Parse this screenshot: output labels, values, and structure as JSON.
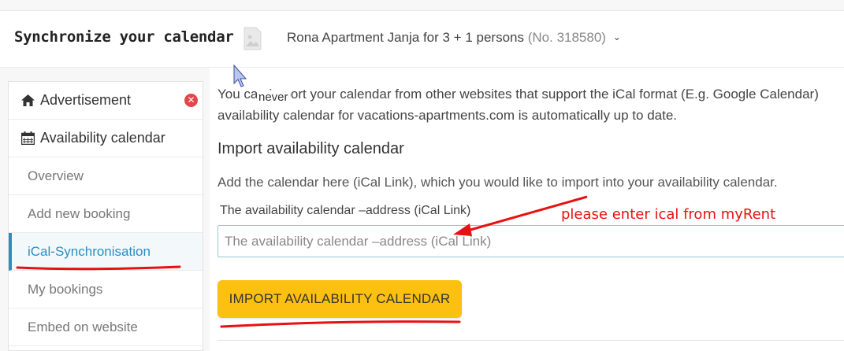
{
  "header": {
    "title": "Synchronize your calendar",
    "property_name": "Rona Apartment Janja for 3 + 1 persons",
    "property_number": "(No. 318580)"
  },
  "sidebar": {
    "items": [
      {
        "label": "Advertisement",
        "icon": "home-icon"
      },
      {
        "label": "Availability calendar",
        "icon": "calendar-icon"
      }
    ],
    "subitems": [
      {
        "label": "Overview"
      },
      {
        "label": "Add new booking"
      },
      {
        "label": "iCal-Synchronisation",
        "active": true
      },
      {
        "label": "My bookings"
      },
      {
        "label": "Embed on website"
      }
    ]
  },
  "main": {
    "intro_line1": "You can import your calendar from other websites that support the iCal format (E.g. Google Calendar)",
    "intro_line2": "availability calendar for vacations-apartments.com is automatically up to date.",
    "never_text": "never",
    "section_title": "Import availability calendar",
    "description": "Add the calendar here (iCal Link), which you would like to import into your availability calendar.",
    "field_label": "The availability calendar –address (iCal Link)",
    "field_placeholder": "The availability calendar –address (iCal Link)",
    "field_value": "",
    "button_label": "IMPORT AVAILABILITY CALENDAR"
  },
  "annotation": {
    "text": "please enter ical from myRent",
    "color": "#e81010"
  },
  "colors": {
    "accent": "#2b8ec2",
    "button": "#fcc010",
    "close": "#e6454b"
  }
}
